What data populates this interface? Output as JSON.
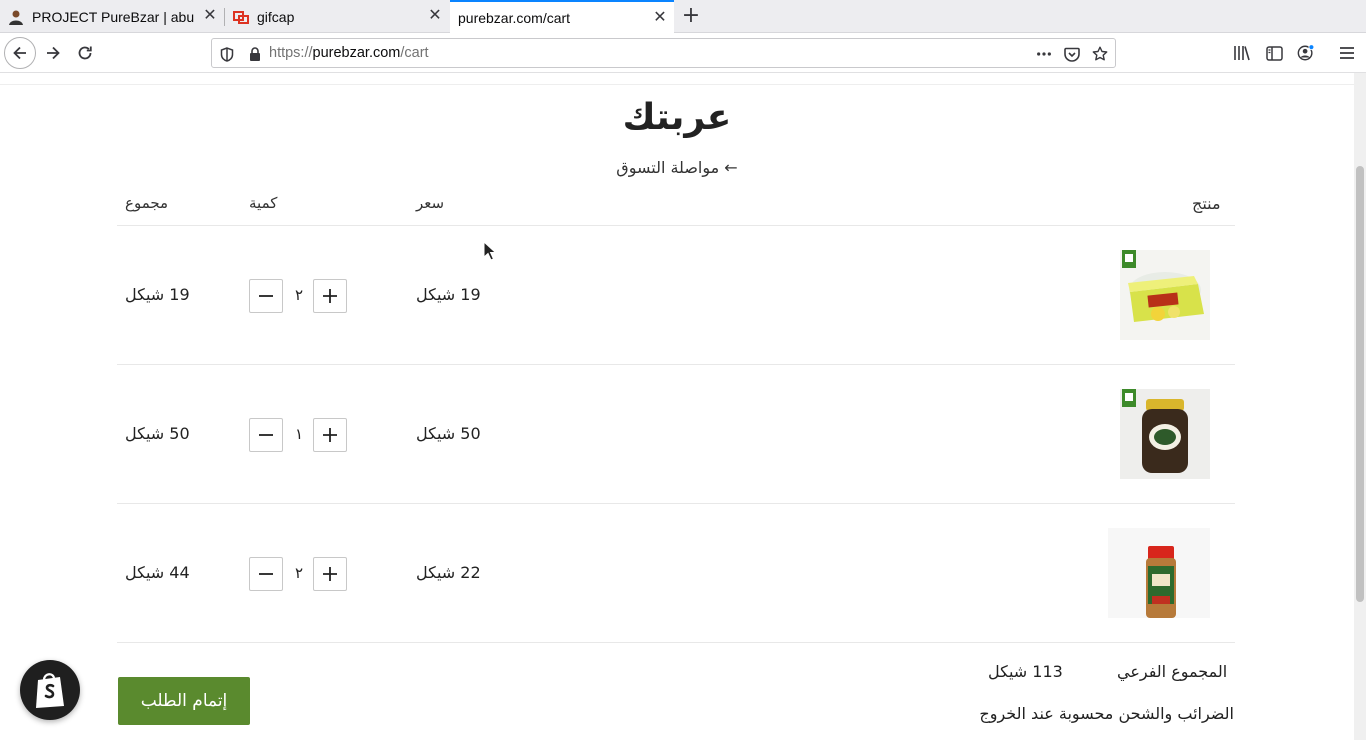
{
  "browser": {
    "tabs": [
      {
        "title": "PROJECT PureBzar | abu",
        "active": false
      },
      {
        "title": "gifcap",
        "active": false
      },
      {
        "title": "purebzar.com/cart",
        "active": true
      }
    ],
    "url": {
      "scheme": "https://",
      "host": "purebzar.com",
      "path": "/cart"
    }
  },
  "page": {
    "title": "عربتك",
    "continue_shopping": "مواصلة التسوق ←",
    "headers": {
      "product": "منتج",
      "price": "سعر",
      "quantity": "كمية",
      "total": "مجموع"
    },
    "items": [
      {
        "price": "19 شيكل",
        "quantity": "٢",
        "total": "19 شيكل"
      },
      {
        "price": "50 شيكل",
        "quantity": "١",
        "total": "50 شيكل"
      },
      {
        "price": "22 شيكل",
        "quantity": "٢",
        "total": "44 شيكل"
      }
    ],
    "subtotal_label": "المجموع الفرعي",
    "subtotal_value": "113 شيكل",
    "tax_note": "الضرائب والشحن محسوبة عند الخروج",
    "checkout_label": "إتمام الطلب"
  },
  "colors": {
    "accent_tab": "#0a84ff",
    "checkout": "#5a8a2e"
  }
}
